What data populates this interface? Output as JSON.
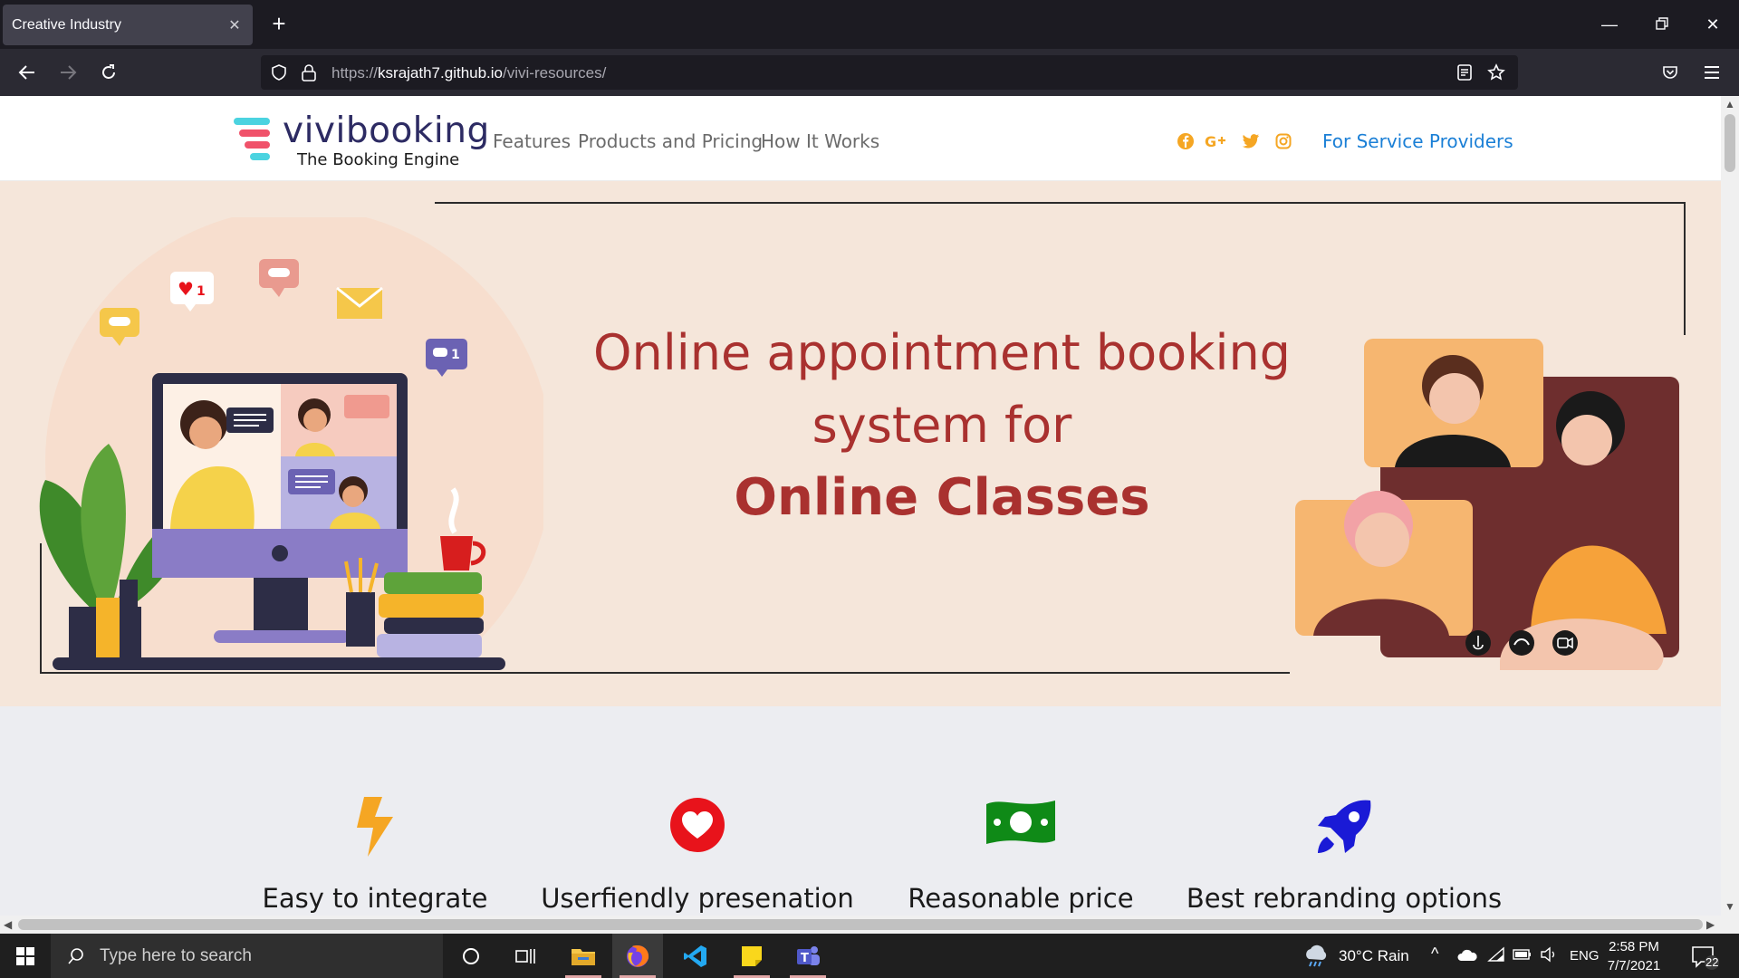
{
  "browser": {
    "tab_title": "Creative Industry",
    "url_host": "https://ksrajath7.github.io",
    "url_path": "/vivi-resources/"
  },
  "site": {
    "brand_name": "vivibooking",
    "brand_tagline": "The Booking Engine",
    "menu": [
      "Features",
      "Products and Pricing",
      "How It Works"
    ],
    "social_icons": [
      "facebook-icon",
      "google-plus-icon",
      "twitter-icon",
      "instagram-icon"
    ],
    "provider_link": "For Service Providers",
    "accent_color": "#a9312f",
    "link_color": "#1a7fd6",
    "social_color": "#f5a623"
  },
  "hero": {
    "line1": "Online appointment booking",
    "line2": "system for",
    "line3": "Online Classes",
    "background": "#f5e6da"
  },
  "features": [
    {
      "label": "Easy to integrate",
      "icon": "bolt-icon",
      "color": "#f5a623"
    },
    {
      "label": "Userfiendly presenation",
      "icon": "heart-icon",
      "color": "#e8131b"
    },
    {
      "label": "Reasonable price",
      "icon": "money-icon",
      "color": "#0f8a17"
    },
    {
      "label": "Best rebranding options",
      "icon": "rocket-icon",
      "color": "#1a1ad6"
    }
  ],
  "taskbar": {
    "search_placeholder": "Type here to search",
    "weather": "30°C  Rain",
    "language": "ENG",
    "time": "2:58 PM",
    "date": "7/7/2021",
    "notification_count": "22"
  }
}
